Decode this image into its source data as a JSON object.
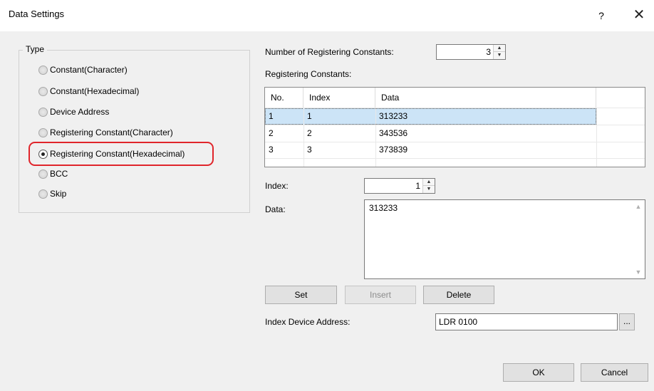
{
  "dialog": {
    "title": "Data Settings",
    "help_icon": "?",
    "close_icon": "✕"
  },
  "type_group": {
    "legend": "Type",
    "options": [
      {
        "label": "Constant(Character)",
        "checked": false
      },
      {
        "label": "Constant(Hexadecimal)",
        "checked": false
      },
      {
        "label": "Device Address",
        "checked": false
      },
      {
        "label": "Registering Constant(Character)",
        "checked": false
      },
      {
        "label": "Registering Constant(Hexadecimal)",
        "checked": true
      },
      {
        "label": "BCC",
        "checked": false
      },
      {
        "label": "Skip",
        "checked": false
      }
    ]
  },
  "num_constants": {
    "label": "Number of Registering Constants:",
    "value": "3"
  },
  "constants_table": {
    "label": "Registering Constants:",
    "columns": [
      "No.",
      "Index",
      "Data"
    ],
    "rows": [
      {
        "no": "1",
        "index": "1",
        "data": "313233"
      },
      {
        "no": "2",
        "index": "2",
        "data": "343536"
      },
      {
        "no": "3",
        "index": "3",
        "data": "373839"
      }
    ]
  },
  "index_field": {
    "label": "Index:",
    "value": "1"
  },
  "data_field": {
    "label": "Data:",
    "value": "313233"
  },
  "buttons": {
    "set": "Set",
    "insert": "Insert",
    "delete": "Delete",
    "ok": "OK",
    "cancel": "Cancel"
  },
  "index_device": {
    "label": "Index Device Address:",
    "value": "LDR 0100",
    "browse": "..."
  }
}
